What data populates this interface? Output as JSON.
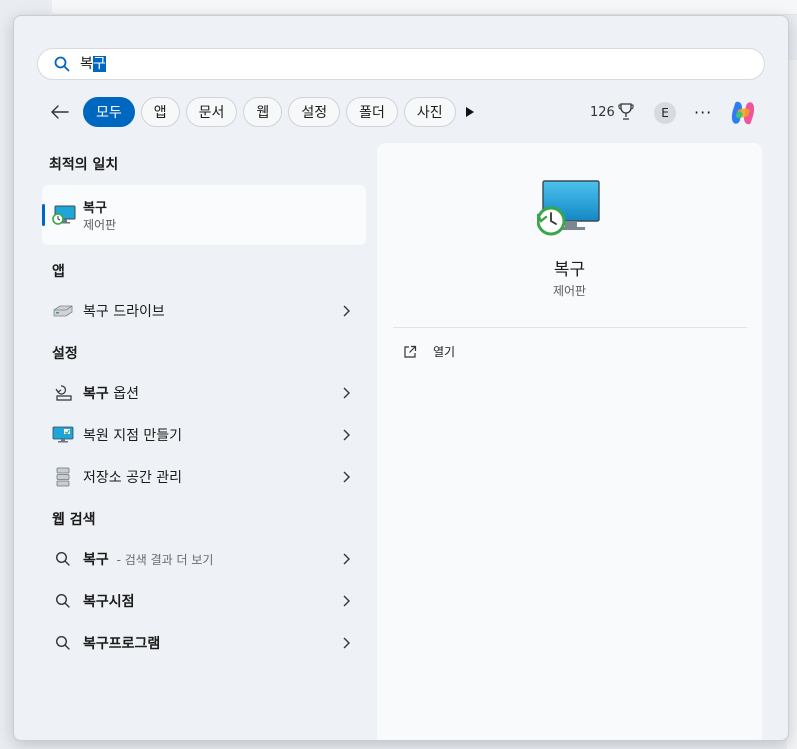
{
  "search": {
    "query_prefix": "복",
    "query_selected": "구"
  },
  "filters": [
    {
      "label": "모두",
      "active": true
    },
    {
      "label": "앱"
    },
    {
      "label": "문서"
    },
    {
      "label": "웹"
    },
    {
      "label": "설정"
    },
    {
      "label": "폴더"
    },
    {
      "label": "사진"
    }
  ],
  "header": {
    "points": "126",
    "avatar_initial": "E"
  },
  "sections": {
    "best_match": "최적의 일치",
    "apps": "앱",
    "settings": "설정",
    "web": "웹 검색"
  },
  "best_match": {
    "title": "복구",
    "subtitle": "제어판"
  },
  "apps": [
    {
      "label": "복구 드라이브"
    }
  ],
  "settings": [
    {
      "label_bold": "복구",
      "label_rest": " 옵션"
    },
    {
      "label_bold": "",
      "label_rest": "복원 지점 만들기"
    },
    {
      "label_bold": "",
      "label_rest": "저장소 공간 관리"
    }
  ],
  "web": [
    {
      "label_bold": "복구",
      "hint": " - 검색 결과 더 보기"
    },
    {
      "label_bold": "복구시점",
      "hint": ""
    },
    {
      "label_bold": "복구프로그램",
      "hint": ""
    }
  ],
  "preview": {
    "title": "복구",
    "subtitle": "제어판",
    "action_open": "열기"
  },
  "colors": {
    "accent": "#0067c0"
  }
}
